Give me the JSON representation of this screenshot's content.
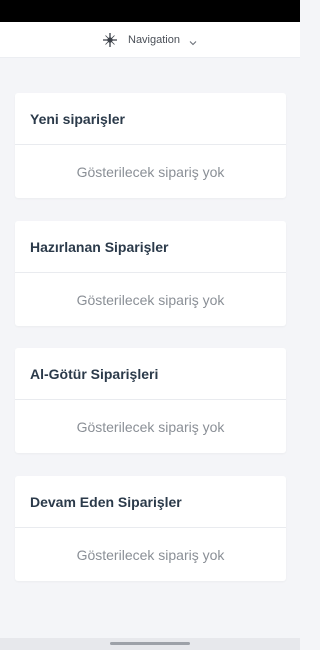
{
  "nav": {
    "label": "Navigation",
    "icon": "compass-icon",
    "chevron": "chevron-down-icon"
  },
  "cards": [
    {
      "title": "Yeni siparişler",
      "empty": "Gösterilecek sipariş yok"
    },
    {
      "title": "Hazırlanan Siparişler",
      "empty": "Gösterilecek sipariş yok"
    },
    {
      "title": "Al-Götür Siparişleri",
      "empty": "Gösterilecek sipariş yok"
    },
    {
      "title": "Devam Eden Siparişler",
      "empty": "Gösterilecek sipariş yok"
    }
  ],
  "colors": {
    "background": "#f4f5f8",
    "card": "#ffffff",
    "title": "#2b3a4a",
    "muted": "#8a8f96"
  }
}
